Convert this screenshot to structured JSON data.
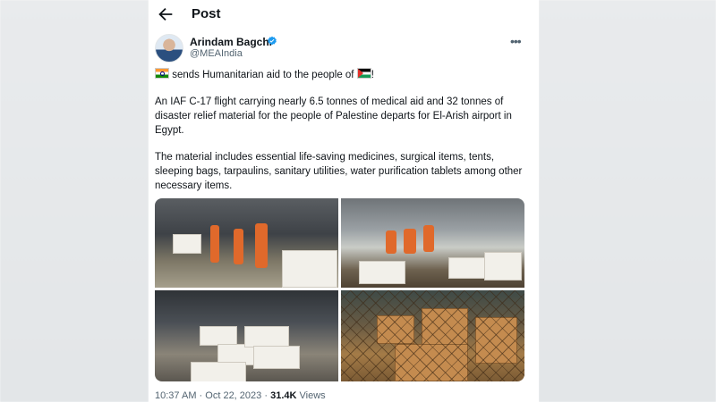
{
  "header": {
    "title": "Post"
  },
  "author": {
    "name": "Arindam Bagchi",
    "handle": "@MEAIndia"
  },
  "tweet": {
    "line1": "sends Humanitarian aid to the people of",
    "line1_end": "!",
    "para1": "An IAF C-17 flight carrying nearly 6.5 tonnes of medical aid and 32 tonnes of disaster relief material for the people of Palestine departs for El-Arish airport in Egypt.",
    "para2": "The material includes essential life-saving medicines, surgical items, tents, sleeping bags, tarpaulins, sanitary utilities, water purification tablets among other necessary items."
  },
  "meta": {
    "time": "10:37 AM",
    "sep": "·",
    "date": "Oct 22, 2023",
    "views_count": "31.4K",
    "views_label": "Views"
  },
  "icons": [
    "back-arrow-icon",
    "verified-badge-icon",
    "more-options-icon",
    "india-flag-icon",
    "palestine-flag-icon"
  ],
  "colors": {
    "verified": "#1d9bf0",
    "text": "#0f1419",
    "secondary": "#536471"
  }
}
